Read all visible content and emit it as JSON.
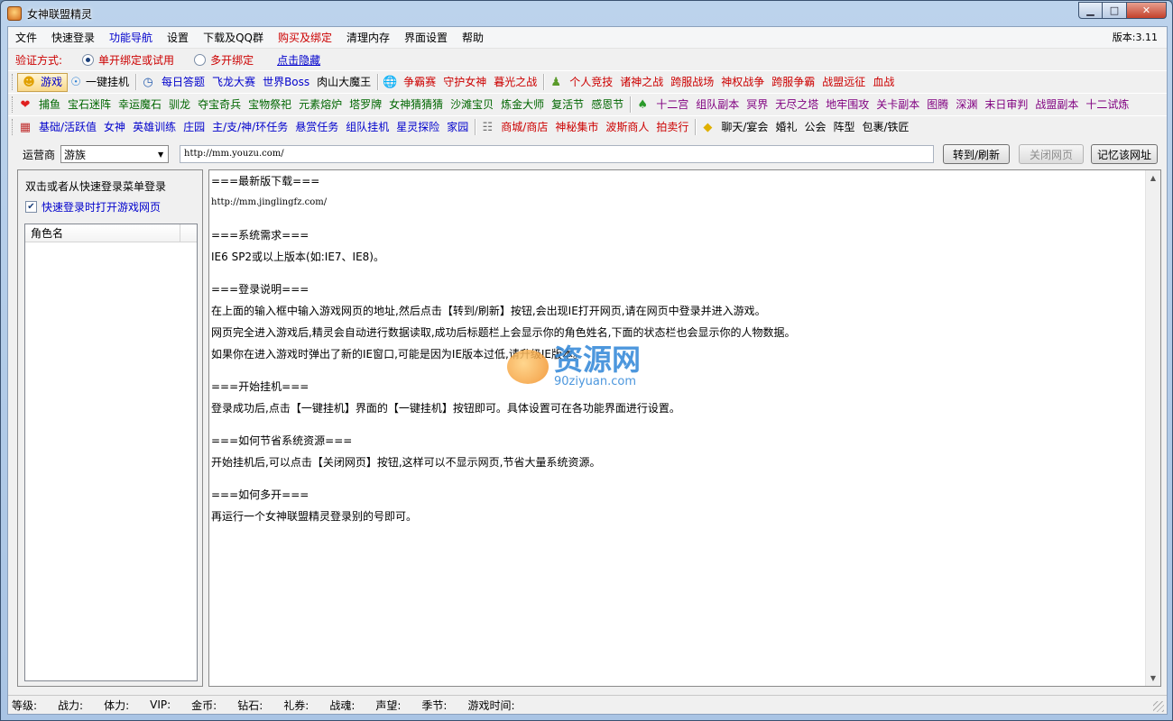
{
  "window": {
    "title": "女神联盟精灵"
  },
  "menubar": {
    "items": [
      {
        "label": "文件",
        "color": "black"
      },
      {
        "label": "快速登录",
        "color": "black"
      },
      {
        "label": "功能导航",
        "color": "blue"
      },
      {
        "label": "设置",
        "color": "black"
      },
      {
        "label": "下载及QQ群",
        "color": "black"
      },
      {
        "label": "购买及绑定",
        "color": "red"
      },
      {
        "label": "清理内存",
        "color": "black"
      },
      {
        "label": "界面设置",
        "color": "black"
      },
      {
        "label": "帮助",
        "color": "black"
      }
    ],
    "version": "版本:3.11"
  },
  "verify": {
    "label": "验证方式:",
    "option1": "单开绑定或试用",
    "option2": "多开绑定",
    "selected": "单开绑定或试用",
    "hide_link": "点击隐藏"
  },
  "toolbar1": {
    "game_btn": "游戏",
    "onekey_btn": "一键挂机",
    "items_a": [
      "每日答题",
      "飞龙大赛",
      "世界Boss",
      "肉山大魔王"
    ],
    "items_b": [
      "争霸赛",
      "守护女神",
      "暮光之战"
    ],
    "items_c": [
      "个人竞技",
      "诸神之战",
      "跨服战场",
      "神权战争",
      "跨服争霸",
      "战盟远征",
      "血战"
    ]
  },
  "toolbar2": {
    "items_a": [
      "捕鱼",
      "宝石迷阵",
      "幸运魔石",
      "驯龙",
      "夺宝奇兵",
      "宝物祭祀",
      "元素熔炉",
      "塔罗牌",
      "女神猜猜猜",
      "沙滩宝贝",
      "炼金大师",
      "复活节",
      "感恩节"
    ],
    "items_b": [
      "十二宫",
      "组队副本",
      "冥界",
      "无尽之塔",
      "地牢围攻",
      "关卡副本",
      "图腾",
      "深渊",
      "末日审判",
      "战盟副本",
      "十二试炼"
    ]
  },
  "toolbar3": {
    "items_a": [
      "基础/活跃值",
      "女神",
      "英雄训练",
      "庄园",
      "主/支/神/环任务",
      "悬赏任务",
      "组队挂机",
      "星灵探险",
      "家园"
    ],
    "items_b": [
      "商城/商店",
      "神秘集市",
      "波斯商人",
      "拍卖行"
    ],
    "items_c": [
      "聊天/宴会",
      "婚礼",
      "公会",
      "阵型",
      "包裹/铁匠"
    ]
  },
  "urlbar": {
    "operator_label": "运营商",
    "operator_value": "游族",
    "url": "http://mm.youzu.com/",
    "goto_btn": "转到/刷新",
    "close_btn": "关闭网页",
    "remember_btn": "记忆该网址"
  },
  "left_panel": {
    "title": "双击或者从快速登录菜单登录",
    "checkbox_label": "快速登录时打开游戏网页",
    "checkbox_checked": true,
    "column_header": "角色名"
  },
  "content": {
    "lines": [
      "===最新版下载===",
      "http://mm.jinglingfz.com/",
      "",
      "===系统需求===",
      "IE6 SP2或以上版本(如:IE7、IE8)。",
      "",
      "===登录说明===",
      "在上面的输入框中输入游戏网页的地址,然后点击【转到/刷新】按钮,会出现IE打开网页,请在网页中登录并进入游戏。",
      "网页完全进入游戏后,精灵会自动进行数据读取,成功后标题栏上会显示你的角色姓名,下面的状态栏也会显示你的人物数据。",
      "如果你在进入游戏时弹出了新的IE窗口,可能是因为IE版本过低,请升级IE版本。",
      "",
      "===开始挂机===",
      "登录成功后,点击【一键挂机】界面的【一键挂机】按钮即可。具体设置可在各功能界面进行设置。",
      "",
      "===如何节省系统资源===",
      "开始挂机后,可以点击【关闭网页】按钮,这样可以不显示网页,节省大量系统资源。",
      "",
      "===如何多开===",
      "再运行一个女神联盟精灵登录别的号即可。"
    ],
    "watermark_big": "资源网",
    "watermark_small": "90ziyuan.com"
  },
  "statusbar": {
    "items": [
      "等级:",
      "战力:",
      "体力:",
      "VIP:",
      "金币:",
      "钻石:",
      "礼券:",
      "战魂:",
      "声望:",
      "季节:",
      "游戏时间:"
    ]
  }
}
